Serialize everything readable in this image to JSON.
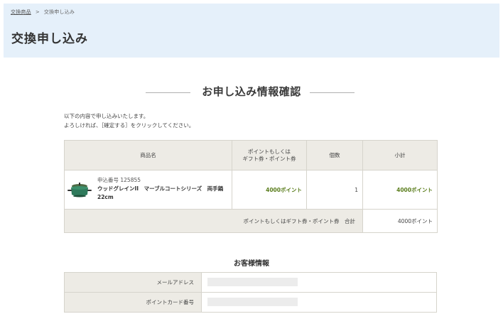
{
  "breadcrumb": {
    "link": "交換商品",
    "separator": ">",
    "current": "交換申し込み"
  },
  "page_title": "交換申し込み",
  "confirm_heading": "お申し込み情報確認",
  "intro": {
    "line1": "以下の内容で申し込みいたします。",
    "line2": "よろしければ、［確定する］をクリックしてください。"
  },
  "order_table": {
    "headers": {
      "product": "商品名",
      "points_line1": "ポイントもしくは",
      "points_line2": "ギフト券・ポイント券",
      "qty": "個数",
      "subtotal": "小計"
    },
    "rows": [
      {
        "order_no": "申込番号 125855",
        "name": "ウッドグレインII　マーブルコートシリーズ　両手鍋22cm",
        "points": "4000ポイント",
        "qty": "1",
        "subtotal": "4000ポイント",
        "image_icon": "pot-icon"
      }
    ],
    "total_label": "ポイントもしくはギフト券・ポイント券　合計",
    "total_value": "4000ポイント"
  },
  "customer": {
    "heading": "お客様情報",
    "fields": [
      {
        "label": "メールアドレス"
      },
      {
        "label": "ポイントカード番号"
      }
    ]
  }
}
